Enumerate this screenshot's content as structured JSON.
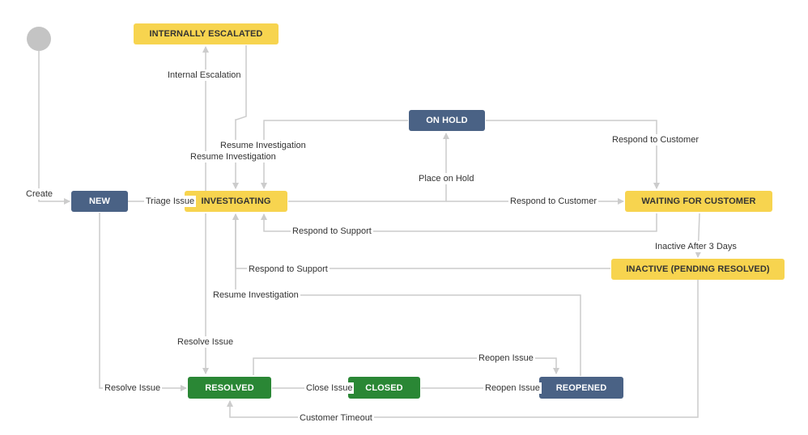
{
  "diagram": {
    "colors": {
      "status_todo": "#4a6285",
      "status_inprogress": "#f7d44f",
      "status_done": "#2a8735",
      "edge": "#cccccc"
    },
    "statuses": {
      "internally_escalated": "INTERNALLY ESCALATED",
      "on_hold": "ON HOLD",
      "new": "NEW",
      "investigating": "INVESTIGATING",
      "waiting_for_customer": "WAITING FOR CUSTOMER",
      "inactive_pending_resolved": "INACTIVE (PENDING RESOLVED)",
      "resolved": "RESOLVED",
      "closed": "CLOSED",
      "reopened": "REOPENED"
    },
    "transitions": {
      "create": "Create",
      "internal_escalation": "Internal Escalation",
      "resume_investigation_1": "Resume Investigation",
      "resume_investigation_2": "Resume Investigation",
      "resume_investigation_3": "Resume Investigation",
      "place_on_hold": "Place on Hold",
      "respond_to_customer_1": "Respond to Customer",
      "respond_to_customer_2": "Respond to Customer",
      "triage_issue": "Triage Issue",
      "respond_to_support_1": "Respond to Support",
      "respond_to_support_2": "Respond to Support",
      "inactive_after_3_days": "Inactive After 3 Days",
      "resolve_issue_1": "Resolve Issue",
      "resolve_issue_2": "Resolve Issue",
      "close_issue": "Close Issue",
      "reopen_issue_1": "Reopen Issue",
      "reopen_issue_2": "Reopen Issue",
      "customer_timeout": "Customer Timeout"
    }
  }
}
